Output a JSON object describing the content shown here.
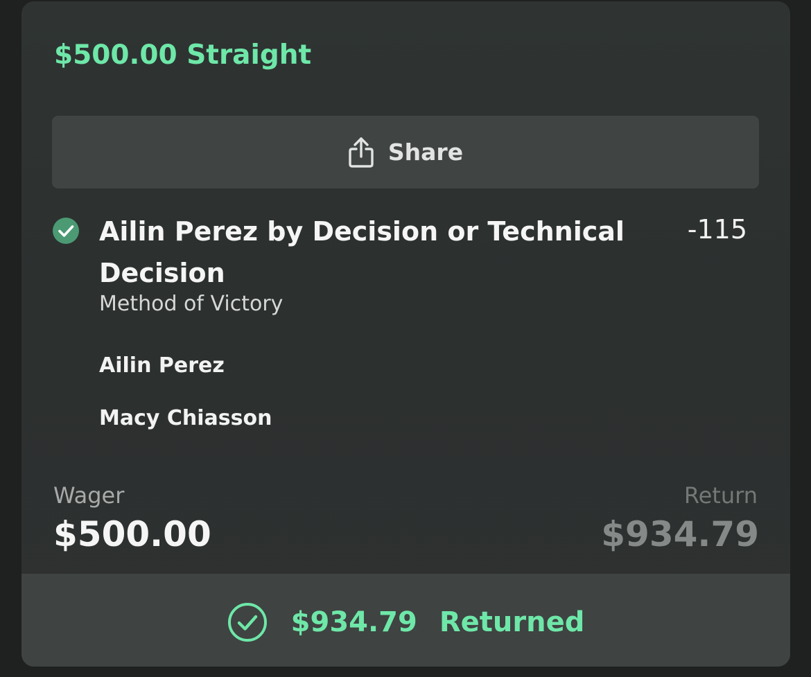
{
  "bet": {
    "title": "$500.00 Straight",
    "share_label": "Share",
    "pick": "Ailin Perez by Decision or Technical Decision",
    "odds": "-115",
    "market": "Method of Victory",
    "fighters": [
      "Ailin Perez",
      "Macy Chiasson"
    ],
    "wager_label": "Wager",
    "wager_value": "$500.00",
    "return_label": "Return",
    "return_value": "$934.79",
    "footer_amount": "$934.79",
    "footer_status": "Returned"
  },
  "icons": {
    "share": "share-icon",
    "pick_status": "check-circle-filled-icon",
    "footer_status": "check-circle-outline-icon"
  },
  "colors": {
    "accent_green": "#6ee7a8",
    "check_fill": "#4b9a74",
    "card_background": "#2e3231",
    "button_background": "#404544"
  }
}
